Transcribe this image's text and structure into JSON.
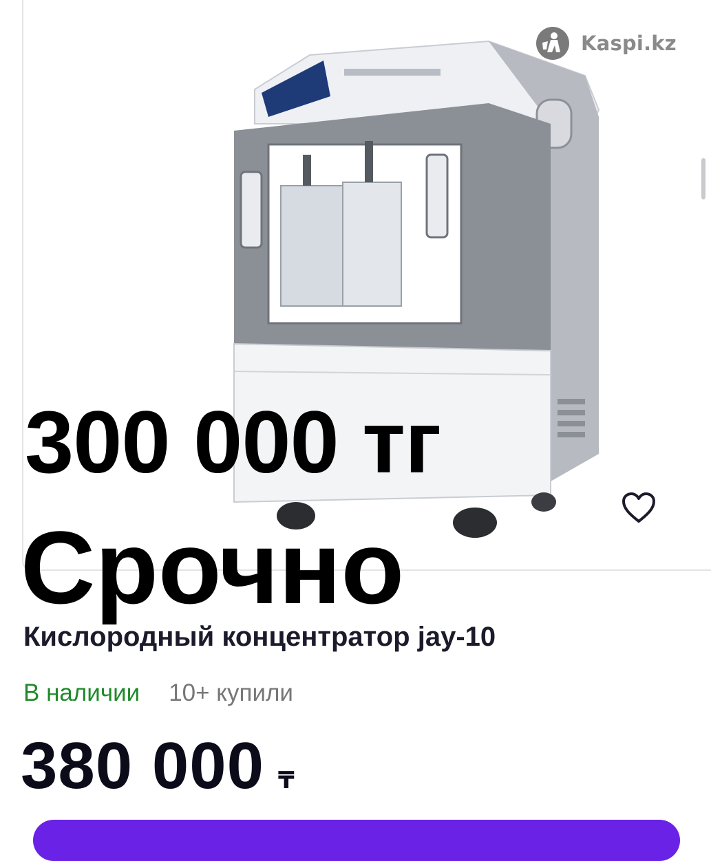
{
  "brand": {
    "logo_text": "Kaspi.kz"
  },
  "overlay": {
    "price_text": "300 000 тг",
    "urgent_text": "Срочно"
  },
  "product": {
    "title": "Кислородный концентратор jay-10",
    "availability": "В наличии",
    "bought_count": "10+ купили",
    "price": "380 000",
    "currency": "₸"
  },
  "icons": {
    "favorite": "heart-outline-icon",
    "logo": "kaspi-logo-icon"
  },
  "colors": {
    "in_stock": "#1f8a2a",
    "muted": "#777777",
    "accent": "#6a22e6",
    "text_dark": "#1b1b2b"
  }
}
